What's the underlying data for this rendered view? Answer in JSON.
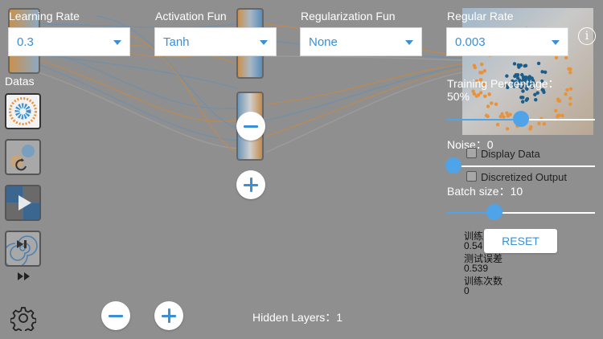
{
  "controls": {
    "learning_rate": {
      "label": "Learning Rate",
      "value": "0.3"
    },
    "activation": {
      "label": "Activation Fun",
      "value": "Tanh"
    },
    "regularization": {
      "label": "Regularization Fun",
      "value": "None"
    },
    "regular_rate": {
      "label": "Regular Rate",
      "value": "0.003"
    }
  },
  "sidebar": {
    "datas_label": "Datas"
  },
  "training": {
    "percentage_label": "Training Percentage：",
    "percentage_value": "50%",
    "percentage": 0.5,
    "noise_label": "Noise：",
    "noise_value": "0",
    "noise": 0,
    "display_data_label": "Display Data",
    "discretized_output_label": "Discretized Output",
    "batch_size_label": "Batch size：",
    "batch_size_value": "10",
    "batch_size_fraction": 0.32
  },
  "stats": {
    "train_loss_label": "训练",
    "train_loss_value": "0.54",
    "test_loss_label": "测试误差",
    "test_loss_value": "0.539",
    "epochs_label": "训练次数",
    "epochs_value": "0"
  },
  "reset_label": "RESET",
  "hidden_layers": {
    "label": "Hidden Layers：",
    "value": "1"
  },
  "colors": {
    "blue": "#3b8fd6",
    "orange": "#e8923a",
    "background": "#8f8f8f",
    "dark_blue": "#1b5e8e"
  },
  "icons": {
    "settings": "gear-icon",
    "info": "info-icon",
    "play": "play-icon",
    "step": "step-icon",
    "reset_arrow": "refresh-icon",
    "fast_forward": "fast-forward-icon"
  }
}
